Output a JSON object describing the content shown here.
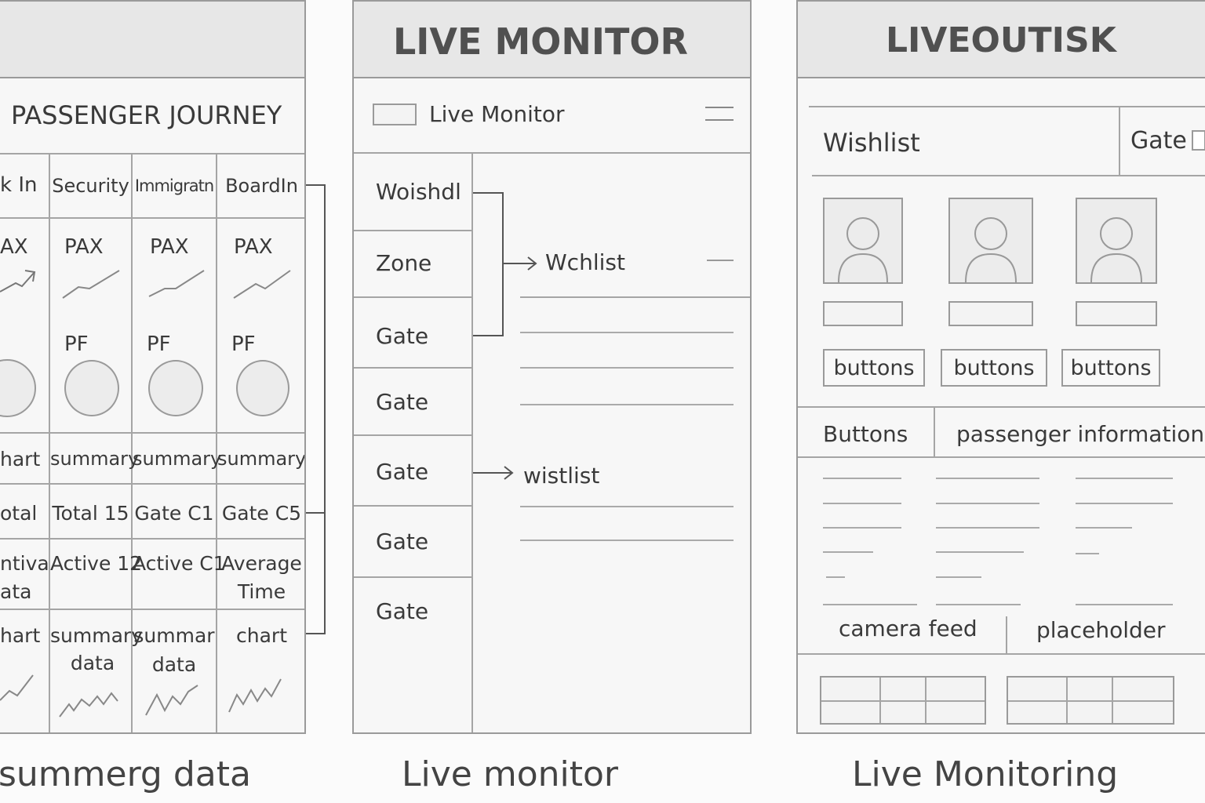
{
  "panel1": {
    "title": "PASSENGER JOURNEY",
    "columns": [
      "k In",
      "Security",
      "Immigratn",
      "BoardIn"
    ],
    "pax": [
      "AX",
      "PAX",
      "PAX",
      "PAX"
    ],
    "pf": [
      "PF",
      "PF",
      "PF"
    ],
    "summary_row": [
      "hart",
      "summary",
      "summary",
      "summary"
    ],
    "totals_row": [
      "otal",
      "Total 15",
      "Gate C1",
      "Gate C5"
    ],
    "active_row": [
      [
        "ntiva",
        "ata"
      ],
      [
        "Active 12"
      ],
      [
        "Active C1"
      ],
      [
        "Average",
        "Time"
      ]
    ],
    "bottom_row": [
      [
        "hart"
      ],
      [
        "summary",
        "data"
      ],
      [
        "summar",
        "data"
      ],
      [
        "chart"
      ]
    ],
    "caption": "summerg data"
  },
  "panel2": {
    "header": "LIVE MONITOR",
    "subheader": "Live Monitor",
    "sidebar": [
      "Woishdl",
      "Zone",
      "Gate",
      "Gate",
      "Gate",
      "Gate",
      "Gate"
    ],
    "arrow_label_1": "Wchlist",
    "arrow_label_2": "wistlist",
    "caption": "Live monitor"
  },
  "panel3": {
    "header": "LIVEOUTISK",
    "wishlist_label": "Wishlist",
    "gate_label": "Gate",
    "card_buttons": [
      "buttons",
      "buttons",
      "buttons"
    ],
    "buttons_label": "Buttons",
    "passenger_info_label": "passenger information",
    "camera_label": "camera feed",
    "placeholder_label": "placeholder",
    "caption": "Live Monitoring"
  }
}
